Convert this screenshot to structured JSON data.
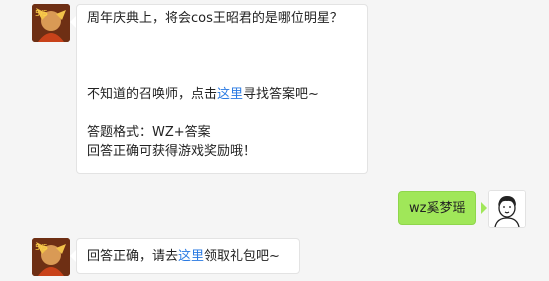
{
  "messages": [
    {
      "sender": "bot",
      "avatar_icon": "game-hero-avatar-icon",
      "lines": [
        {
          "text": "周年庆典上，将会cos王昭君的是哪位明星？"
        },
        {
          "text": ""
        },
        {
          "text": ""
        },
        {
          "text": ""
        },
        {
          "pre": "不知道的召唤师，点击",
          "link": "这里",
          "post": "寻找答案吧~"
        },
        {
          "text": ""
        },
        {
          "text": "答题格式：WZ+答案"
        },
        {
          "text": "回答正确可获得游戏奖励哦！"
        }
      ]
    },
    {
      "sender": "user",
      "avatar_icon": "user-avatar-icon",
      "text": "wz奚梦瑶"
    },
    {
      "sender": "bot",
      "avatar_icon": "game-hero-avatar-icon",
      "pre": "回答正确，请去",
      "link": "这里",
      "post": "领取礼包吧~"
    }
  ],
  "colors": {
    "background": "#f5f5f5",
    "bot_bubble": "#ffffff",
    "user_bubble": "#a0e759",
    "link": "#2a7ae2"
  }
}
